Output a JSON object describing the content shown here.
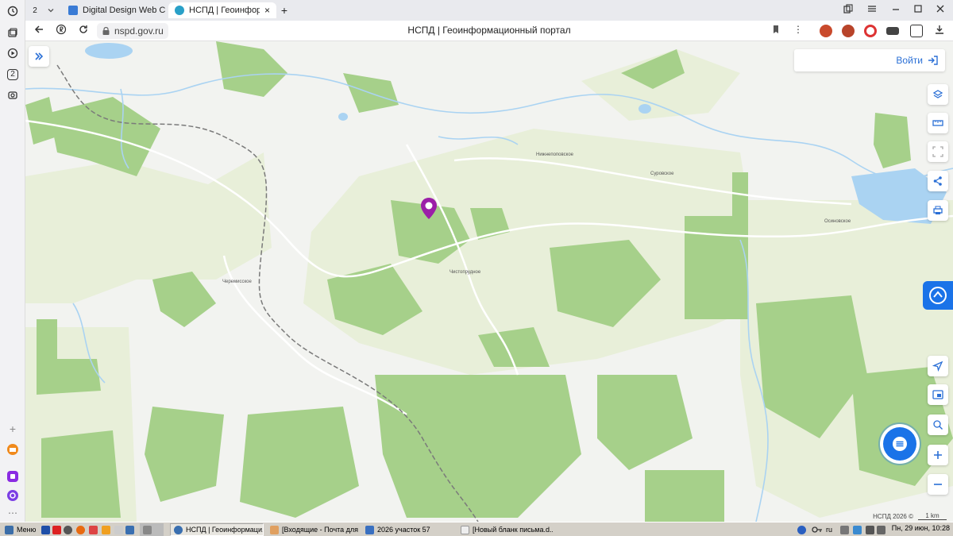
{
  "browser": {
    "tab_count_badge": "2",
    "tabs": [
      {
        "label": "Digital Design Web Client",
        "favicon_color": "#3a7bd5"
      },
      {
        "label": "НСПД | Геоинформацио",
        "favicon_color": "#29a0c8"
      }
    ],
    "new_tab_symbol": "+",
    "close_symbol": "×",
    "url": "nspd.gov.ru",
    "page_title": "НСПД | Геоинформационный портал",
    "side_badge": "2"
  },
  "map": {
    "login_label": "Войти",
    "places": [
      "Нижнепоповское",
      "Суровское",
      "Осиновское",
      "Чистопрудное",
      "Черемисское"
    ],
    "attribution": "НСПД 2026 ©",
    "scale_label": "1 km",
    "colors": {
      "forest": "#a6d08a",
      "field": "#e8efd9",
      "water": "#aad3f2",
      "road": "#ffffff",
      "rail": "#777777",
      "marker": "#9b1fa8"
    }
  },
  "taskbar": {
    "menu_label": "Меню",
    "tasks": [
      "НСПД | Геоинформаци...",
      "[Входящие - Почта для ...",
      "2026 участок 57",
      "[Новый бланк письма.d..."
    ],
    "lang": "ru",
    "clock": "Пн, 29 июн, 10:28"
  }
}
